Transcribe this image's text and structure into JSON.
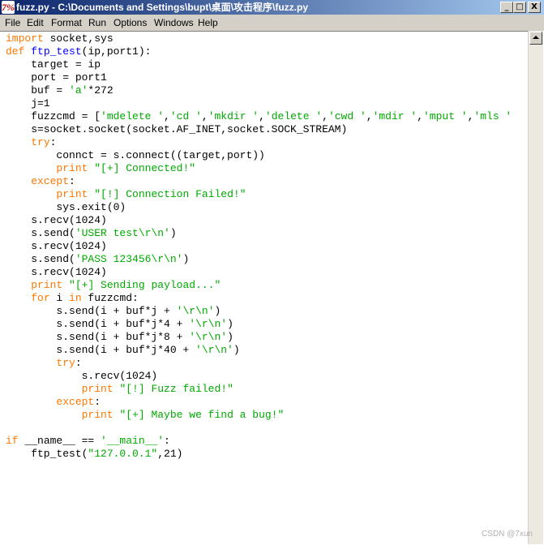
{
  "window": {
    "title": "fuzz.py - C:\\Documents and Settings\\bupt\\桌面\\攻击程序\\fuzz.py",
    "controls": {
      "minimize": "_",
      "maximize": "□",
      "close": "X"
    }
  },
  "menu": [
    "File",
    "Edit",
    "Format",
    "Run",
    "Options",
    "Windows",
    "Help"
  ],
  "code": {
    "lines": [
      [
        [
          "kw",
          "import"
        ],
        [
          "n",
          " socket,sys"
        ]
      ],
      [
        [
          "kw",
          "def"
        ],
        [
          "n",
          " "
        ],
        [
          "fn",
          "ftp_test"
        ],
        [
          "n",
          "(ip,port1):"
        ]
      ],
      [
        [
          "n",
          "    target = ip"
        ]
      ],
      [
        [
          "n",
          "    port = port1"
        ]
      ],
      [
        [
          "n",
          "    buf = "
        ],
        [
          "st",
          "'a'"
        ],
        [
          "n",
          "*272"
        ]
      ],
      [
        [
          "n",
          "    j=1"
        ]
      ],
      [
        [
          "n",
          "    fuzzcmd = ["
        ],
        [
          "st",
          "'mdelete '"
        ],
        [
          "n",
          ","
        ],
        [
          "st",
          "'cd '"
        ],
        [
          "n",
          ","
        ],
        [
          "st",
          "'mkdir '"
        ],
        [
          "n",
          ","
        ],
        [
          "st",
          "'delete '"
        ],
        [
          "n",
          ","
        ],
        [
          "st",
          "'cwd '"
        ],
        [
          "n",
          ","
        ],
        [
          "st",
          "'mdir '"
        ],
        [
          "n",
          ","
        ],
        [
          "st",
          "'mput '"
        ],
        [
          "n",
          ","
        ],
        [
          "st",
          "'mls '"
        ]
      ],
      [
        [
          "n",
          "    s=socket.socket(socket.AF_INET,socket.SOCK_STREAM)"
        ]
      ],
      [
        [
          "n",
          "    "
        ],
        [
          "kw",
          "try"
        ],
        [
          "n",
          ":"
        ]
      ],
      [
        [
          "n",
          "        connct = s.connect((target,port))"
        ]
      ],
      [
        [
          "n",
          "        "
        ],
        [
          "kw",
          "print"
        ],
        [
          "n",
          " "
        ],
        [
          "st",
          "\"[+] Connected!\""
        ]
      ],
      [
        [
          "n",
          "    "
        ],
        [
          "kw",
          "except"
        ],
        [
          "n",
          ":"
        ]
      ],
      [
        [
          "n",
          "        "
        ],
        [
          "kw",
          "print"
        ],
        [
          "n",
          " "
        ],
        [
          "st",
          "\"[!] Connection Failed!\""
        ]
      ],
      [
        [
          "n",
          "        sys.exit(0)"
        ]
      ],
      [
        [
          "n",
          "    s.recv(1024)"
        ]
      ],
      [
        [
          "n",
          "    s.send("
        ],
        [
          "st",
          "'USER test\\r\\n'"
        ],
        [
          "n",
          ")"
        ]
      ],
      [
        [
          "n",
          "    s.recv(1024)"
        ]
      ],
      [
        [
          "n",
          "    s.send("
        ],
        [
          "st",
          "'PASS 123456\\r\\n'"
        ],
        [
          "n",
          ")"
        ]
      ],
      [
        [
          "n",
          "    s.recv(1024)"
        ]
      ],
      [
        [
          "n",
          "    "
        ],
        [
          "kw",
          "print"
        ],
        [
          "n",
          " "
        ],
        [
          "st",
          "\"[+] Sending payload...\""
        ]
      ],
      [
        [
          "n",
          "    "
        ],
        [
          "kw",
          "for"
        ],
        [
          "n",
          " i "
        ],
        [
          "kw",
          "in"
        ],
        [
          "n",
          " fuzzcmd:"
        ]
      ],
      [
        [
          "n",
          "        s.send(i + buf*j + "
        ],
        [
          "st",
          "'\\r\\n'"
        ],
        [
          "n",
          ")"
        ]
      ],
      [
        [
          "n",
          "        s.send(i + buf*j*4 + "
        ],
        [
          "st",
          "'\\r\\n'"
        ],
        [
          "n",
          ")"
        ]
      ],
      [
        [
          "n",
          "        s.send(i + buf*j*8 + "
        ],
        [
          "st",
          "'\\r\\n'"
        ],
        [
          "n",
          ")"
        ]
      ],
      [
        [
          "n",
          "        s.send(i + buf*j*40 + "
        ],
        [
          "st",
          "'\\r\\n'"
        ],
        [
          "n",
          ")"
        ]
      ],
      [
        [
          "n",
          "        "
        ],
        [
          "kw",
          "try"
        ],
        [
          "n",
          ":"
        ]
      ],
      [
        [
          "n",
          "            s.recv(1024)"
        ]
      ],
      [
        [
          "n",
          "            "
        ],
        [
          "kw",
          "print"
        ],
        [
          "n",
          " "
        ],
        [
          "st",
          "\"[!] Fuzz failed!\""
        ]
      ],
      [
        [
          "n",
          "        "
        ],
        [
          "kw",
          "except"
        ],
        [
          "n",
          ":"
        ]
      ],
      [
        [
          "n",
          "            "
        ],
        [
          "kw",
          "print"
        ],
        [
          "n",
          " "
        ],
        [
          "st",
          "\"[+] Maybe we find a bug!\""
        ]
      ],
      [
        [
          "n",
          ""
        ]
      ],
      [
        [
          "kw",
          "if"
        ],
        [
          "n",
          " __name__ == "
        ],
        [
          "st",
          "'__main__'"
        ],
        [
          "n",
          ":"
        ]
      ],
      [
        [
          "n",
          "    ftp_test("
        ],
        [
          "st",
          "\"127.0.0.1\""
        ],
        [
          "n",
          ",21)"
        ]
      ]
    ]
  },
  "watermark": "CSDN @7xun",
  "colors": {
    "keyword": "#ff7700",
    "string": "#00aa00",
    "funcname": "#0000ff",
    "titlebar": "#0a246a"
  },
  "icons": {
    "app": "python-idle-icon"
  }
}
